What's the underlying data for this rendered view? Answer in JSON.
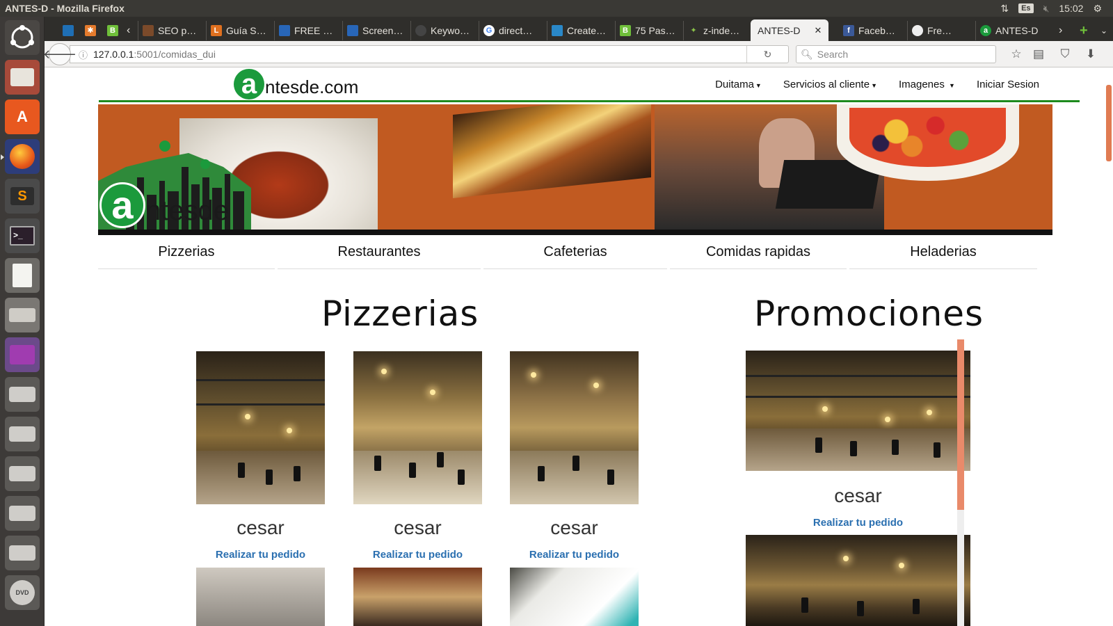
{
  "system": {
    "window_title": "ANTES-D - Mozilla Firefox",
    "keyboard": "Es",
    "clock": "15:02"
  },
  "launcher": {
    "items": [
      "ubuntu-dash-icon",
      "files-icon",
      "software-center-icon",
      "firefox-icon",
      "sublime-text-icon",
      "terminal-icon",
      "text-editor-icon",
      "scanner-icon",
      "app-icon",
      "drive-icon",
      "drive-icon",
      "drive-icon",
      "drive-icon",
      "drive-icon",
      "dvd-icon"
    ]
  },
  "tabs": [
    {
      "label": "SEO p…"
    },
    {
      "label": "Guía S…"
    },
    {
      "label": "FREE …"
    },
    {
      "label": "Screen…"
    },
    {
      "label": "Keywo…"
    },
    {
      "label": "direct…"
    },
    {
      "label": "Create…"
    },
    {
      "label": "75 Pas…"
    },
    {
      "label": "z-inde…"
    },
    {
      "label": "ANTES-D",
      "active": true
    },
    {
      "label": "Faceb…"
    },
    {
      "label": "Fre…"
    },
    {
      "label": "ANTES-D"
    }
  ],
  "url": {
    "host": "127.0.0.1",
    "rest": ":5001/comidas_dui"
  },
  "search": {
    "placeholder": "Search"
  },
  "site": {
    "logo_letter": "a",
    "logo_text": "ntesde.com",
    "nav": [
      {
        "label": "Duitama",
        "caret": true
      },
      {
        "label": "Servicios al cliente",
        "caret": true
      },
      {
        "label": "Imagenes",
        "caret": true
      },
      {
        "label": "Iniciar Sesion",
        "caret": false
      }
    ],
    "banner_logo_letter": "a",
    "banner_logo_text": "ntesde",
    "food_tabs": [
      "Pizzerias",
      "Restaurantes",
      "Cafeterias",
      "Comidas rapidas",
      "Heladerias"
    ],
    "section_title": "Pizzerias",
    "promo_title": "Promociones",
    "cards": [
      {
        "name": "cesar",
        "link": "Realizar tu pedido"
      },
      {
        "name": "cesar",
        "link": "Realizar tu pedido"
      },
      {
        "name": "cesar",
        "link": "Realizar tu pedido"
      }
    ],
    "promo_cards": [
      {
        "name": "cesar",
        "link": "Realizar tu pedido"
      }
    ]
  },
  "colors": {
    "brand_green": "#1b9a3c",
    "banner_orange": "#c15a21",
    "link_blue": "#2a6fb0",
    "accent_scroll": "#e07b52"
  }
}
